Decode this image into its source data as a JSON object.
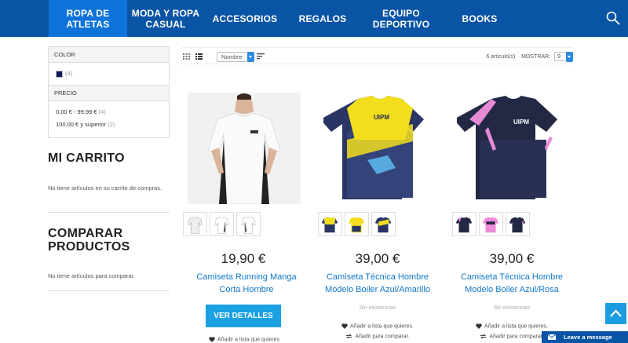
{
  "nav": {
    "items": [
      {
        "line1": "ROPA DE",
        "line2": "ATLETAS",
        "active": true
      },
      {
        "line1": "MODA Y ROPA",
        "line2": "CASUAL"
      },
      {
        "line1": "ACCESORIOS",
        "line2": ""
      },
      {
        "line1": "REGALOS",
        "line2": ""
      },
      {
        "line1": "EQUIPO",
        "line2": "DEPORTIVO"
      },
      {
        "line1": "BOOKS",
        "line2": ""
      }
    ],
    "search_icon": "search-icon",
    "colors": {
      "bar": "#0a54a6",
      "active": "#0e73d8"
    }
  },
  "filters": {
    "color": {
      "heading": "COLOR",
      "count": "(4)",
      "swatch": "#0f1a5a"
    },
    "price": {
      "heading": "PRECIO",
      "options": [
        {
          "label": "0,00 € - 99,99 €",
          "count": "(4)"
        },
        {
          "label": "100,00 € y superior",
          "count": "(2)"
        }
      ]
    }
  },
  "cart": {
    "title": "MI CARRITO",
    "empty_text": "No tiene artículos en su carrito de compras."
  },
  "compare": {
    "title_line1": "COMPARAR",
    "title_line2": "PRODUCTOS",
    "empty_text": "No tiene artículos para comparar."
  },
  "toolbar": {
    "sort_value": "Nombre",
    "count_text": "6 artículo(s)",
    "show_label": "MOSTRAR:",
    "show_value": "9"
  },
  "products": [
    {
      "price": "19,90 €",
      "name_line1": "Camiseta Running Manga",
      "name_line2": "Corta Hombre",
      "button": "VER DETALLES",
      "wishlist": "Añadir a lista que quieres"
    },
    {
      "price": "39,00 €",
      "name_line1": "Camiseta Técnica Hombre",
      "name_line2": "Modelo Boiler Azul/Amarillo",
      "stock": "Sin existencias",
      "wishlist": "Añadir a lista que quieres.",
      "compare": "Añadir para comparar."
    },
    {
      "price": "39,00 €",
      "name_line1": "Camiseta Técnica Hombre",
      "name_line2": "Modelo Boiler Azul/Rosa",
      "stock": "Sin existencias",
      "wishlist": "Añadir a lista que quieres.",
      "compare": "Añadir para comparar."
    }
  ],
  "chat": {
    "label": "Leave a message"
  },
  "colors": {
    "link": "#1178c9",
    "button": "#1aa0e3"
  }
}
